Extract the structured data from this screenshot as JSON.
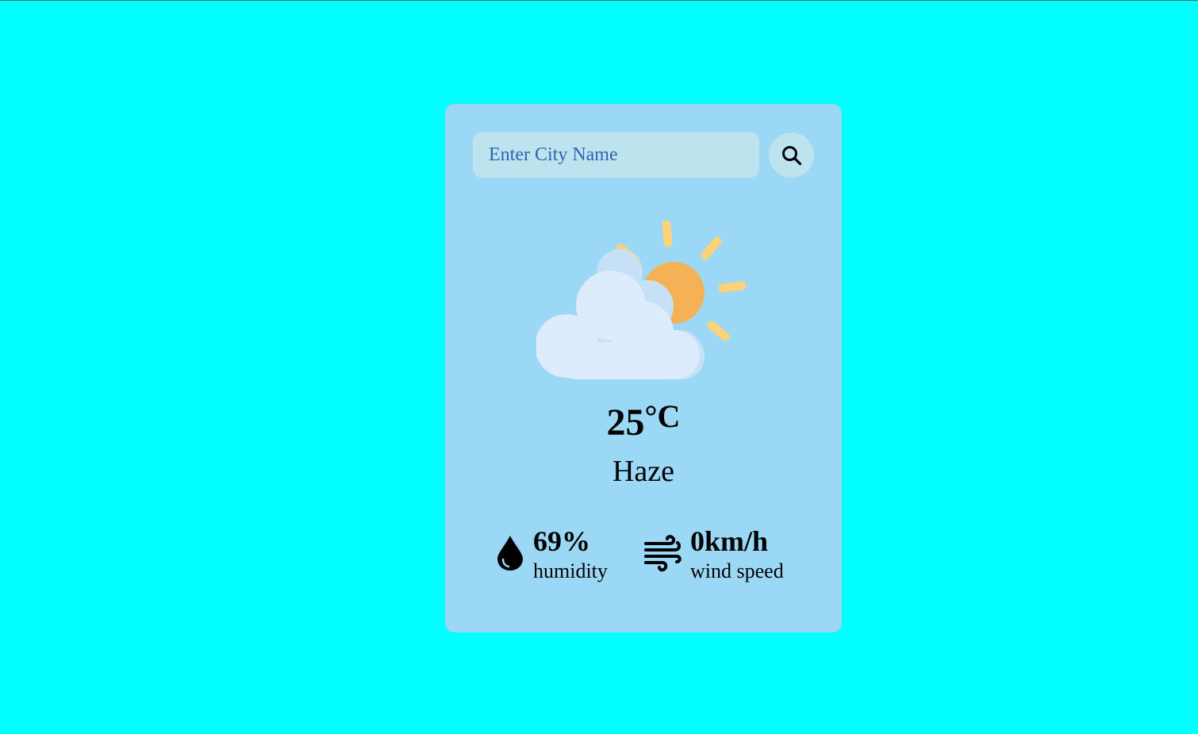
{
  "search": {
    "placeholder": "Enter City Name",
    "value": ""
  },
  "weather": {
    "icon": "partly-cloudy-icon",
    "temperature": "25",
    "unit": "°C",
    "condition": "Haze"
  },
  "details": {
    "humidity": {
      "icon": "water-drop-icon",
      "value": "69%",
      "label": "humidity"
    },
    "wind": {
      "icon": "wind-icon",
      "value": "0km/h",
      "label": "wind speed"
    }
  },
  "colors": {
    "page_background": "#00ffff",
    "card_background": "#9ad8f5",
    "input_background": "#bde3ef",
    "sun": "#f5b155",
    "sun_rays": "#fcd27a",
    "cloud": "#dcecfc"
  }
}
